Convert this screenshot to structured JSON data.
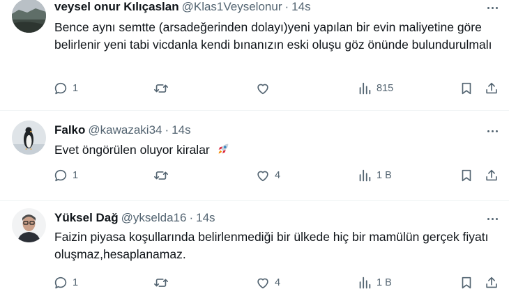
{
  "tweets": [
    {
      "name": "veysel onur Kılıçaslan",
      "handle": "@Klas1Veyselonur",
      "time": "14s",
      "text": "Bence aynı semtte (arsadeğerinden dolayı)yeni yapılan bir evin maliyetine göre belirlenir yeni tabi vicdanla kendi bınanızın eski oluşu göz önünde bulundurulmalı",
      "replies": "1",
      "reposts": "",
      "likes": "",
      "views": "815"
    },
    {
      "name": "Falko",
      "handle": "@kawazaki34",
      "time": "14s",
      "text": "Evet öngörülen oluyor kiralar",
      "replies": "1",
      "reposts": "",
      "likes": "4",
      "views": "1 B"
    },
    {
      "name": "Yüksel Dağ",
      "handle": "@ykselda16",
      "time": "14s",
      "text": "Faizin piyasa koşullarında belirlenmediği bir ülkede hiç bir mamülün gerçek fiyatı oluşmaz,hesaplanamaz.",
      "replies": "1",
      "reposts": "",
      "likes": "4",
      "views": "1 B"
    }
  ],
  "icons": {
    "reply": "reply-icon",
    "repost": "repost-icon",
    "like": "like-icon",
    "views": "views-icon",
    "bookmark": "bookmark-icon",
    "share": "share-icon",
    "more": "more-icon",
    "rocket": "rocket-emoji-icon"
  },
  "colors": {
    "text": "#0f1419",
    "secondary": "#536471",
    "divider": "#eff3f4"
  }
}
